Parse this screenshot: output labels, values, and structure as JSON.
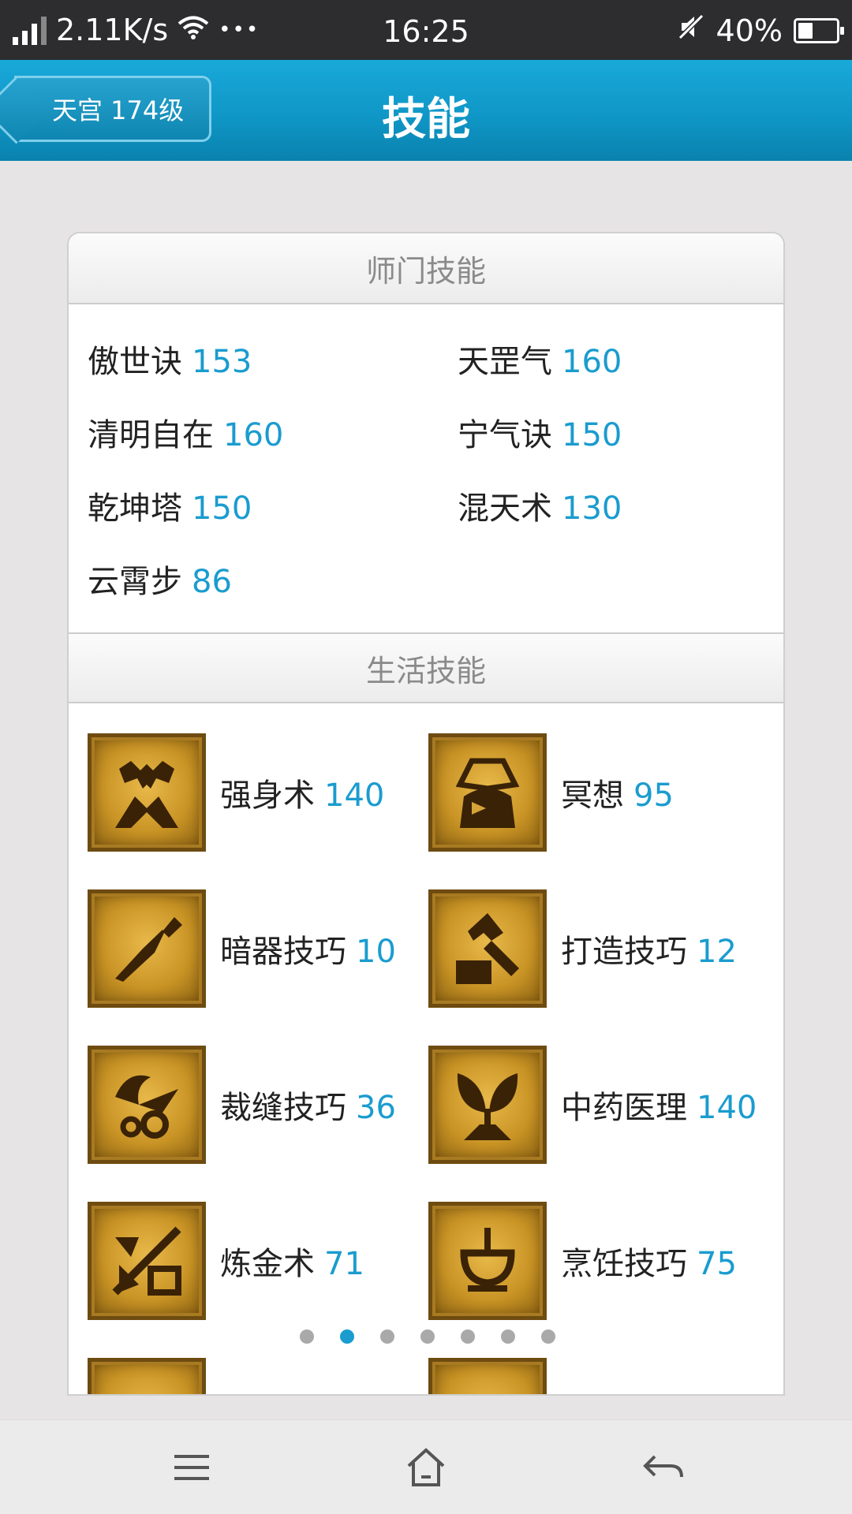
{
  "status_bar": {
    "net_speed": "2.11K/s",
    "more": "•••",
    "time": "16:25",
    "battery": "40%",
    "battery_level": 0.4
  },
  "header": {
    "back_label": "天宫 174级",
    "title": "技能"
  },
  "school_section": {
    "title": "师门技能",
    "skills": [
      {
        "name": "傲世诀",
        "level": "153"
      },
      {
        "name": "天罡气",
        "level": "160"
      },
      {
        "name": "清明自在",
        "level": "160"
      },
      {
        "name": "宁气诀",
        "level": "150"
      },
      {
        "name": "乾坤塔",
        "level": "150"
      },
      {
        "name": "混天术",
        "level": "130"
      },
      {
        "name": "云霄步",
        "level": "86"
      }
    ]
  },
  "life_section": {
    "title": "生活技能",
    "skills": [
      {
        "name": "强身术",
        "level": "140",
        "icon": "strength-icon"
      },
      {
        "name": "冥想",
        "level": "95",
        "icon": "meditation-icon"
      },
      {
        "name": "暗器技巧",
        "level": "10",
        "icon": "dart-icon"
      },
      {
        "name": "打造技巧",
        "level": "12",
        "icon": "anvil-hammer-icon"
      },
      {
        "name": "裁缝技巧",
        "level": "36",
        "icon": "scissors-icon"
      },
      {
        "name": "中药医理",
        "level": "140",
        "icon": "herb-icon"
      },
      {
        "name": "炼金术",
        "level": "71",
        "icon": "alchemy-icon"
      },
      {
        "name": "烹饪技巧",
        "level": "75",
        "icon": "cooking-icon"
      }
    ]
  },
  "pager": {
    "count": 7,
    "active": 1
  },
  "colors": {
    "accent": "#1a9ccf",
    "header": "#0f97c7",
    "status_bar": "#2d2d30"
  }
}
